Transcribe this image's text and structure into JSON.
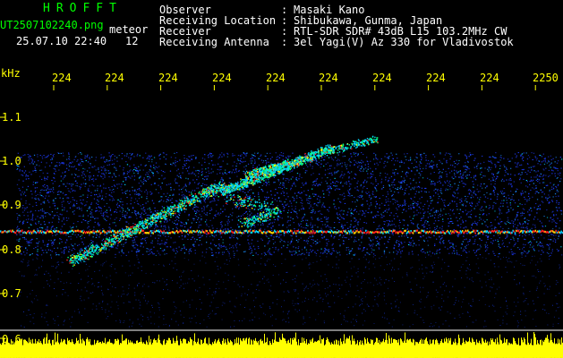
{
  "title": "HROFFT",
  "left_info": {
    "filename": "UT2507102240.png",
    "filename_suffix": "meteor",
    "datetime": "25.07.10 22:40",
    "count": "12"
  },
  "header": {
    "rows": [
      {
        "label": "Observer",
        "value": "Masaki Kano"
      },
      {
        "label": "Receiving Location",
        "value": "Shibukawa, Gunma, Japan"
      },
      {
        "label": "Receiver",
        "value": "RTL-SDR SDR# 43dB L15 103.2MHz CW"
      },
      {
        "label": "Receiving Antenna",
        "value": "3el Yagi(V) Az 330 for Vladivostok"
      }
    ],
    "separator": ":"
  },
  "time_axis": {
    "labels": [
      "224",
      "224",
      "224",
      "224",
      "224",
      "224",
      "224",
      "224",
      "224",
      "2250"
    ]
  },
  "freq_axis": {
    "unit": "kHz",
    "labels": [
      "1.1",
      "1.0",
      "0.9",
      "0.8",
      "0.7",
      "0.6"
    ]
  },
  "colors": {
    "background": "#000000",
    "title": "#00ff00",
    "header_text": "#ffffff",
    "ticks": "#ffff00",
    "noise_blue": "#1f3cff",
    "noise_cyan": "#00d8ff",
    "signal_red": "#ff2020",
    "bars": "#ffff00"
  }
}
